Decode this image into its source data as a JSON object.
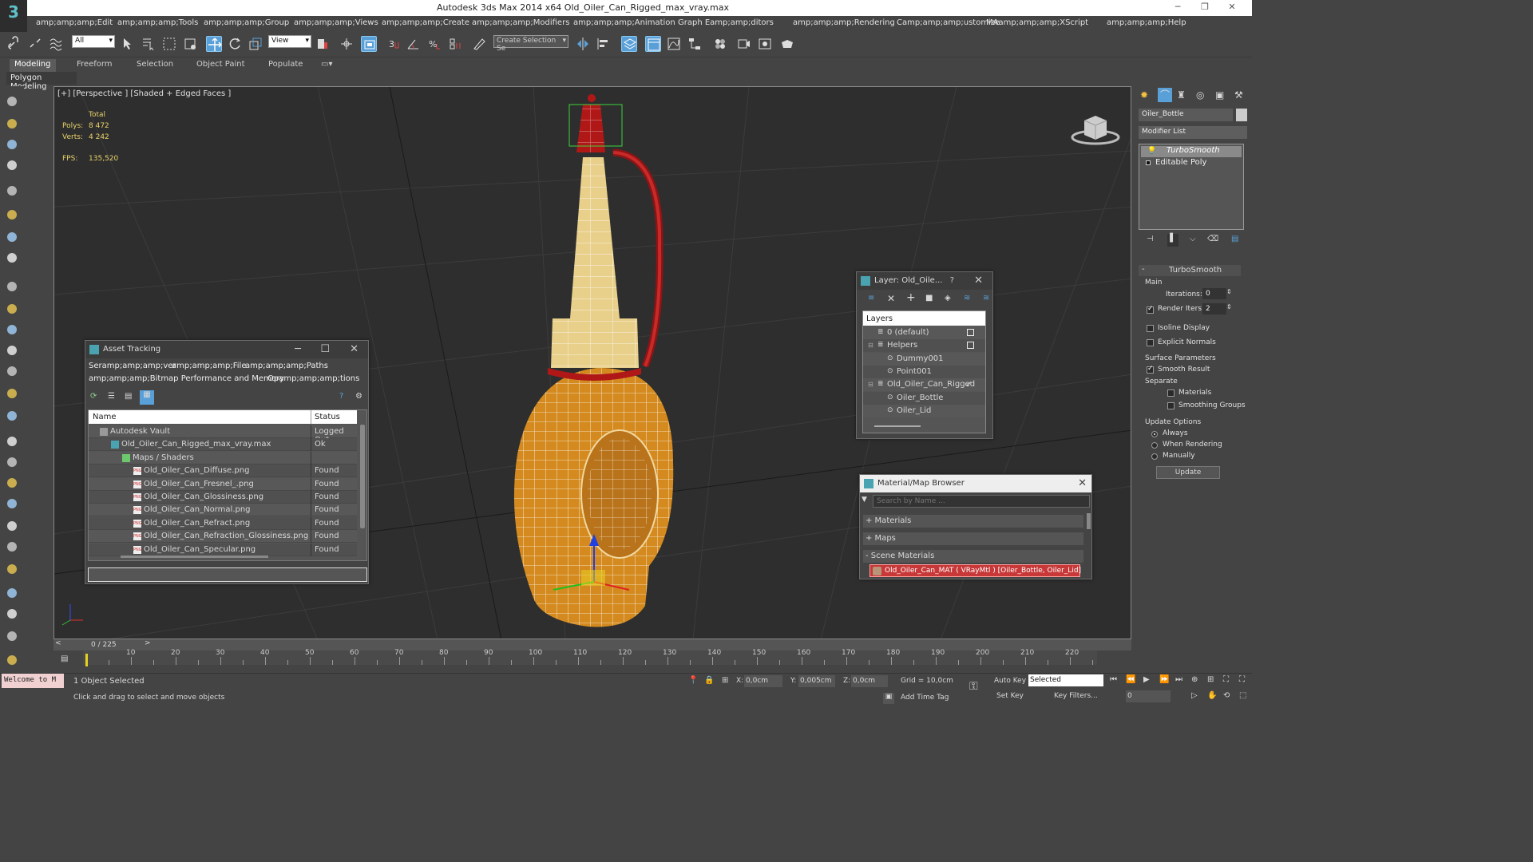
{
  "app": {
    "title": "Autodesk 3ds Max  2014 x64     Old_Oiler_Can_Rigged_max_vray.max",
    "logo": "3"
  },
  "menu": [
    "amp;amp;amp;Edit",
    "amp;amp;amp;Tools",
    "amp;amp;amp;Group",
    "amp;amp;amp;Views",
    "amp;amp;amp;Create",
    "amp;amp;amp;Modifiers",
    "amp;amp;amp;Animation",
    "Graph Eamp;amp;ditors",
    "amp;amp;amp;Rendering",
    "Camp;amp;amp;ustomize",
    "MAamp;amp;amp;XScript",
    "amp;amp;amp;Help"
  ],
  "toolbar": {
    "selection_filter": "All",
    "ref_coord": "View",
    "named_selection": "Create Selection Se"
  },
  "ribbon": {
    "tabs": [
      "Modeling",
      "Freeform",
      "Selection",
      "Object Paint",
      "Populate"
    ],
    "sub_label": "Polygon Modeling"
  },
  "viewport": {
    "label": "[+] [Perspective ] [Shaded + Edged Faces ]",
    "stats": {
      "total_label": "Total",
      "polys_label": "Polys:",
      "polys": "8 472",
      "verts_label": "Verts:",
      "verts": "4 242",
      "fps_label": "FPS:",
      "fps": "135,520"
    }
  },
  "asset_tracking": {
    "title": "Asset Tracking",
    "menu1": [
      "Seramp;amp;amp;ver",
      "amp;amp;amp;File",
      "amp;amp;amp;Paths"
    ],
    "menu2": [
      "amp;amp;amp;Bitmap Performance and Memory",
      "Opamp;amp;amp;tions"
    ],
    "col_name": "Name",
    "col_status": "Status",
    "rows": [
      {
        "name": "Autodesk Vault",
        "status": "Logged Out",
        "indent": 1
      },
      {
        "name": "Old_Oiler_Can_Rigged_max_vray.max",
        "status": "Ok",
        "indent": 2
      },
      {
        "name": "Maps / Shaders",
        "status": "",
        "indent": 3
      },
      {
        "name": "Old_Oiler_Can_Diffuse.png",
        "status": "Found",
        "indent": 4
      },
      {
        "name": "Old_Oiler_Can_Fresnel_.png",
        "status": "Found",
        "indent": 4
      },
      {
        "name": "Old_Oiler_Can_Glossiness.png",
        "status": "Found",
        "indent": 4
      },
      {
        "name": "Old_Oiler_Can_Normal.png",
        "status": "Found",
        "indent": 4
      },
      {
        "name": "Old_Oiler_Can_Refract.png",
        "status": "Found",
        "indent": 4
      },
      {
        "name": "Old_Oiler_Can_Refraction_Glossiness.png",
        "status": "Found",
        "indent": 4
      },
      {
        "name": "Old_Oiler_Can_Specular.png",
        "status": "Found",
        "indent": 4
      }
    ]
  },
  "layer_window": {
    "title": "Layer: Old_Oile...",
    "help": "?",
    "header": "Layers",
    "rows": [
      {
        "name": "0 (default)",
        "indent": 1,
        "box": true
      },
      {
        "name": "Helpers",
        "indent": 1,
        "box": true
      },
      {
        "name": "Dummy001",
        "indent": 2
      },
      {
        "name": "Point001",
        "indent": 2
      },
      {
        "name": "Old_Oiler_Can_Rigged",
        "indent": 1,
        "check": true
      },
      {
        "name": "Oiler_Bottle",
        "indent": 2
      },
      {
        "name": "Oiler_Lid",
        "indent": 2
      }
    ]
  },
  "material_browser": {
    "title": "Material/Map Browser",
    "search_placeholder": "Search by Name ...",
    "sections": [
      "+ Materials",
      "+ Maps",
      "- Scene Materials"
    ],
    "scene_material": "Old_Oiler_Can_MAT ( VRayMtl ) [Oiler_Bottle, Oiler_Lid]"
  },
  "command_panel": {
    "object_name": "Oiler_Bottle",
    "modifier_list": "Modifier List",
    "stack": [
      "TurboSmooth",
      "Editable Poly"
    ],
    "rollout_title": "TurboSmooth",
    "main_label": "Main",
    "iterations_label": "Iterations:",
    "iterations": "0",
    "render_iters_label": "Render Iters:",
    "render_iters": "2",
    "isoline": "Isoline Display",
    "explicit_normals": "Explicit Normals",
    "surface_params": "Surface Parameters",
    "smooth_result": "Smooth Result",
    "separate": "Separate",
    "materials": "Materials",
    "smoothing_groups": "Smoothing Groups",
    "update_options": "Update Options",
    "always": "Always",
    "when_rendering": "When Rendering",
    "manually": "Manually",
    "update_btn": "Update"
  },
  "timeline": {
    "frame": "0 / 225",
    "ticks": [
      "10",
      "20",
      "30",
      "40",
      "50",
      "60",
      "70",
      "80",
      "90",
      "100",
      "110",
      "120",
      "130",
      "140",
      "150",
      "160",
      "170",
      "180",
      "190",
      "200",
      "210",
      "220"
    ]
  },
  "status": {
    "welcome": "Welcome to M",
    "selected": "1 Object Selected",
    "hint": "Click and drag to select and move objects",
    "x_label": "X:",
    "x": "0,0cm",
    "y_label": "Y:",
    "y": "0,005cm",
    "z_label": "Z:",
    "z": "0,0cm",
    "grid": "Grid = 10,0cm",
    "add_time_tag": "Add Time Tag",
    "auto_key": "Auto Key",
    "set_key": "Set Key",
    "key_mode": "Selected",
    "key_filters": "Key Filters...",
    "frame_field": "0"
  },
  "colors": {
    "accent": "#5aa0d8",
    "bottle_body": "#d48a1e",
    "bottle_neck": "#e8cf8a",
    "cap_red": "#b01818",
    "stat_yellow": "#e8d26a"
  }
}
